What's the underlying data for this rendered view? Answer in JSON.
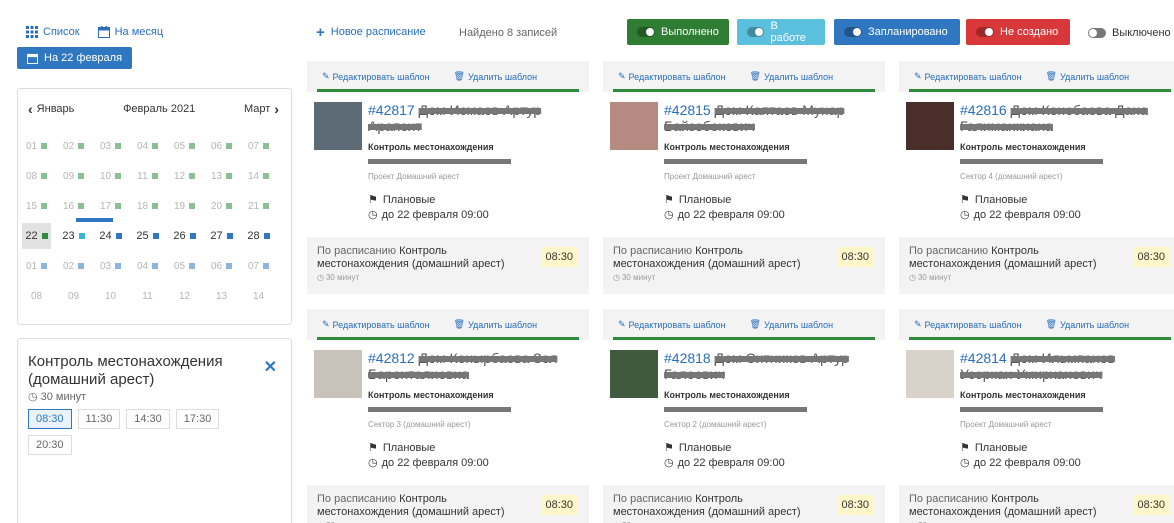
{
  "toolbar": {
    "list_label": "Список",
    "month_label": "На месяц",
    "date_button": "На 22 февраля",
    "new_schedule": "Новое расписание",
    "found": "Найдено 8 записей"
  },
  "legend": [
    {
      "label": "Выполнено",
      "color": "#2e7d32"
    },
    {
      "label": "В работе",
      "color": "#5bc0de"
    },
    {
      "label": "Запланировано",
      "color": "#2f77c0"
    },
    {
      "label": "Не создано",
      "color": "#d9383a"
    }
  ],
  "legend_off": "Выключено",
  "calendar": {
    "prev": "Январь",
    "current": "Февраль 2021",
    "next": "Март",
    "weeks": [
      [
        {
          "d": "01",
          "dot": "g",
          "faded": true
        },
        {
          "d": "02",
          "dot": "g",
          "faded": true
        },
        {
          "d": "03",
          "dot": "g",
          "faded": true
        },
        {
          "d": "04",
          "dot": "g",
          "faded": true
        },
        {
          "d": "05",
          "dot": "g",
          "faded": true
        },
        {
          "d": "06",
          "dot": "g",
          "faded": true
        },
        {
          "d": "07",
          "dot": "g",
          "faded": true
        }
      ],
      [
        {
          "d": "08",
          "dot": "g",
          "faded": true
        },
        {
          "d": "09",
          "dot": "g",
          "faded": true
        },
        {
          "d": "10",
          "dot": "g",
          "faded": true
        },
        {
          "d": "11",
          "dot": "g",
          "faded": true
        },
        {
          "d": "12",
          "dot": "g",
          "faded": true
        },
        {
          "d": "13",
          "dot": "g",
          "faded": true
        },
        {
          "d": "14",
          "dot": "g",
          "faded": true
        }
      ],
      [
        {
          "d": "15",
          "dot": "g",
          "faded": true
        },
        {
          "d": "16",
          "dot": "g",
          "faded": true
        },
        {
          "d": "17",
          "dot": "g",
          "faded": true
        },
        {
          "d": "18",
          "dot": "g",
          "faded": true
        },
        {
          "d": "19",
          "dot": "g",
          "faded": true
        },
        {
          "d": "20",
          "dot": "g",
          "faded": true
        },
        {
          "d": "21",
          "dot": "g",
          "faded": true
        }
      ],
      [
        {
          "d": "22",
          "dot": "g",
          "today": true
        },
        {
          "d": "23",
          "dot": "lb"
        },
        {
          "d": "24",
          "dot": "b"
        },
        {
          "d": "25",
          "dot": "b"
        },
        {
          "d": "26",
          "dot": "b"
        },
        {
          "d": "27",
          "dot": "b"
        },
        {
          "d": "28",
          "dot": "b"
        }
      ],
      [
        {
          "d": "01",
          "dot": "b",
          "faded": true
        },
        {
          "d": "02",
          "dot": "b",
          "faded": true
        },
        {
          "d": "03",
          "dot": "b",
          "faded": true
        },
        {
          "d": "04",
          "dot": "b",
          "faded": true
        },
        {
          "d": "05",
          "dot": "b",
          "faded": true
        },
        {
          "d": "06",
          "dot": "b",
          "faded": true
        },
        {
          "d": "07",
          "dot": "b",
          "faded": true
        }
      ],
      [
        {
          "d": "08",
          "faded": true
        },
        {
          "d": "09",
          "faded": true
        },
        {
          "d": "10",
          "faded": true
        },
        {
          "d": "11",
          "faded": true
        },
        {
          "d": "12",
          "faded": true
        },
        {
          "d": "13",
          "faded": true
        },
        {
          "d": "14",
          "faded": true
        }
      ]
    ]
  },
  "detail": {
    "title": "Контроль местонахождения (домашний арест)",
    "duration": "30 минут",
    "times": [
      "08:30",
      "11:30",
      "14:30",
      "17:30",
      "20:30"
    ],
    "selected": "08:30"
  },
  "card_common": {
    "edit": "Редактировать шаблон",
    "delete": "Удалить шаблон",
    "type": "Контроль местонахождения",
    "flag": "Плановые",
    "due": "до 22 февраля 09:00",
    "foot_prefix": "По расписанию",
    "foot_task": "Контроль местонахождения",
    "foot_suffix": "(домашний арест)",
    "time": "08:30",
    "duration": "30 минут"
  },
  "cards": [
    {
      "id": "#42817",
      "name": "Дом Исмаев Артур Арапсит",
      "project": "Проект Домашний арест",
      "photo": "#5c6b75"
    },
    {
      "id": "#42815",
      "name": "Дом Каптаев Мунар Байзебекович",
      "project": "Проект Домашний арест",
      "photo": "#b58a80"
    },
    {
      "id": "#42816",
      "name": "Дом Конебаева Дана Галиманкиана",
      "project": "Сектор 4 (домашний арест)",
      "photo": "#4a2e2a"
    },
    {
      "id": "#42812",
      "name": "Дом Конырбаева Зол Баронталиевна",
      "project": "Сектор 3 (домашний арест)",
      "photo": "#c9c2bb"
    },
    {
      "id": "#42818",
      "name": "Дом Ситников Артур Галеевич",
      "project": "Сектор 2 (домашний арест)",
      "photo": "#3f5a3e"
    },
    {
      "id": "#42814",
      "name": "Дом Ильмпанов Усеркан Умирханович",
      "project": "Проект Домашний арест",
      "photo": "#d8d2ca"
    }
  ]
}
